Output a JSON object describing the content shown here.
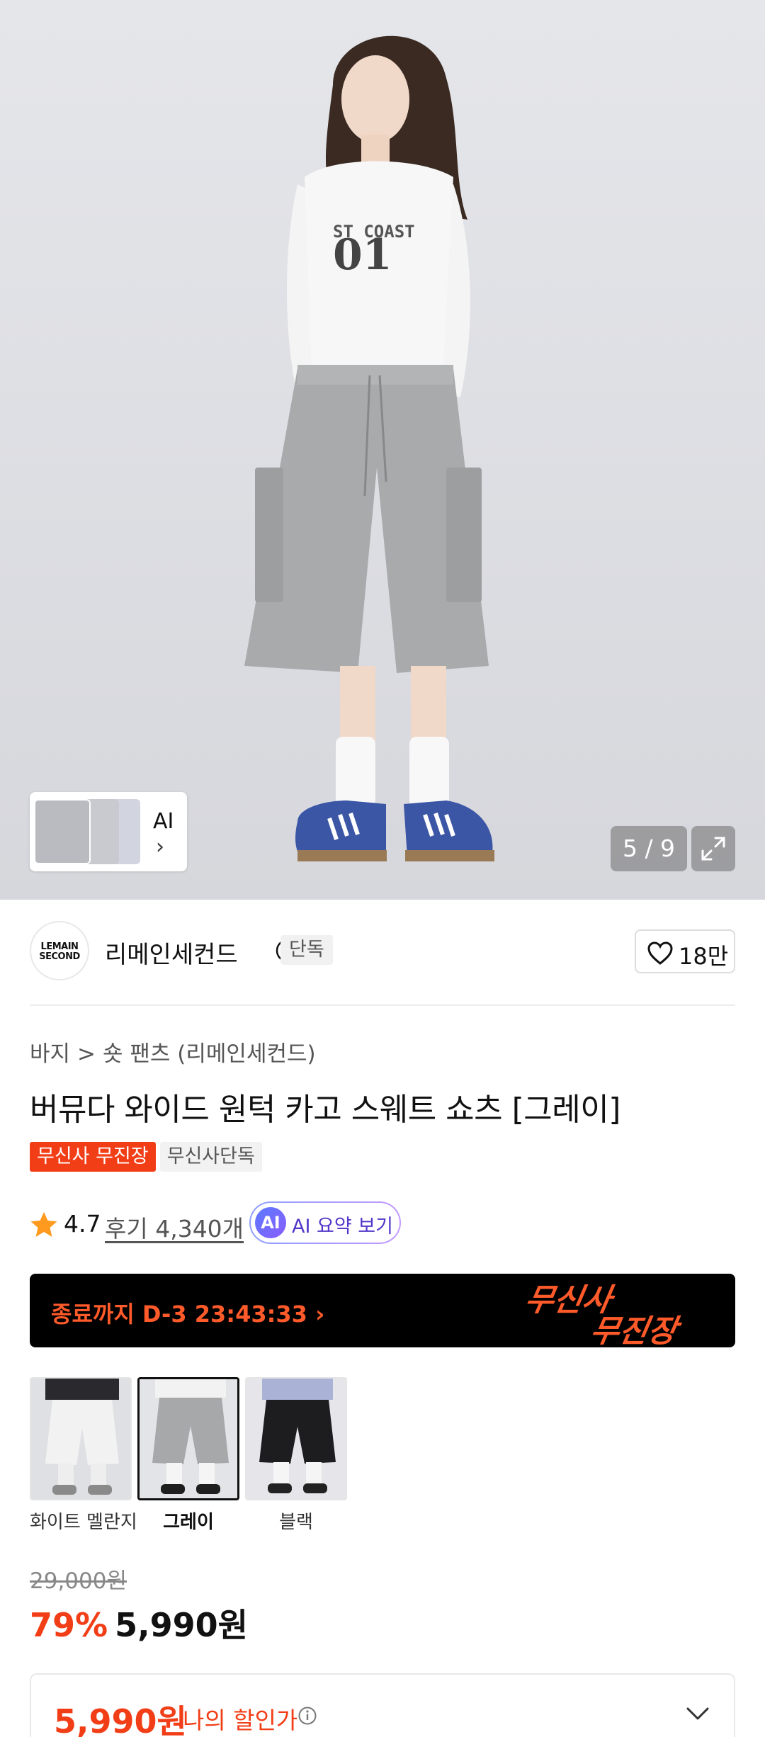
{
  "hero": {
    "ai_label": "AI",
    "ai_chevron": "›",
    "pager": "5 / 9",
    "expand_icon": "expand-icon"
  },
  "brand": {
    "logo_text_line1": "LEMAIN",
    "logo_text_line2": "SECOND",
    "name": "리메인세컨드",
    "badge": "단독",
    "like_count": "18만"
  },
  "breadcrumb": {
    "category": "바지",
    "separator": ">",
    "subcategory": "숏 팬츠 (리메인세컨드)"
  },
  "product": {
    "title": "버뮤다 와이드 원턱 카고 스웨트 쇼츠 [그레이]",
    "badges": [
      "무신사 무진장",
      "무신사단독"
    ],
    "rating": "4.7",
    "reviews": "후기 4,340개",
    "ai_summary_icon": "AI",
    "ai_summary": "AI 요약 보기"
  },
  "promo": {
    "countdown": "종료까지 D-3 23:43:33 ›",
    "logo_line1": "무신사",
    "logo_line2": "무진장"
  },
  "colors": [
    {
      "label": "화이트 멜란지",
      "selected": false
    },
    {
      "label": "그레이",
      "selected": true
    },
    {
      "label": "블랙",
      "selected": false
    }
  ],
  "price": {
    "original": "29,000원",
    "discount": "79%",
    "final": "5,990원",
    "my_price": "5,990원",
    "my_price_label": "나의 할인가"
  },
  "accent_colors": {
    "brand_red": "#f23e17",
    "promo_orange": "#ff5a2a",
    "ai_purple": "#5136c9"
  }
}
